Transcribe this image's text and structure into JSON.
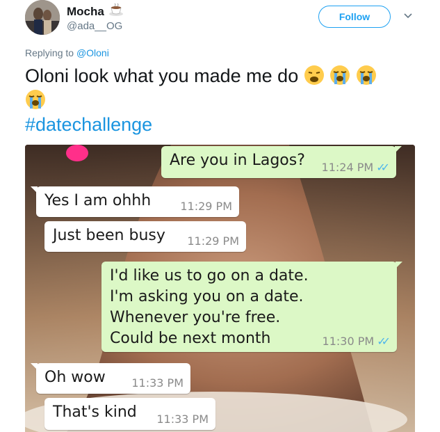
{
  "user": {
    "display_name": "Mocha",
    "handle": "@ada__OG",
    "follow_label": "Follow",
    "name_emoji": "coffee-cup-icon"
  },
  "reply": {
    "prefix": "Replying to",
    "mention": "@Oloni"
  },
  "tweet": {
    "text": "Oloni look what you made me do",
    "emojis": [
      "weary-face-icon",
      "crying-face-icon",
      "crying-face-icon",
      "crying-face-icon"
    ],
    "hashtag": "#datechallenge"
  },
  "chat": {
    "messages": [
      {
        "direction": "out",
        "text": "Are you in Lagos?",
        "time": "11:24 PM",
        "ticks": "✓✓"
      },
      {
        "direction": "in",
        "text": "Yes I am ohhh",
        "time": "11:29 PM"
      },
      {
        "direction": "in",
        "text": "Just been busy",
        "time": "11:29 PM"
      },
      {
        "direction": "out",
        "text": "I'd like us to go on a date.\nI'm asking you on a date.\nWhenever you're free.\nCould be next month",
        "time": "11:30 PM",
        "ticks": "✓✓"
      },
      {
        "direction": "in",
        "text": "Oh wow",
        "time": "11:33 PM"
      },
      {
        "direction": "in",
        "text": "That's kind",
        "time": "11:33 PM"
      }
    ]
  },
  "colors": {
    "link": "#1b95e0",
    "follow_blue": "#1da1f2",
    "outgoing_bubble": "#dcf8c6",
    "incoming_bubble": "#ffffff",
    "read_ticks": "#4fb6ec"
  }
}
